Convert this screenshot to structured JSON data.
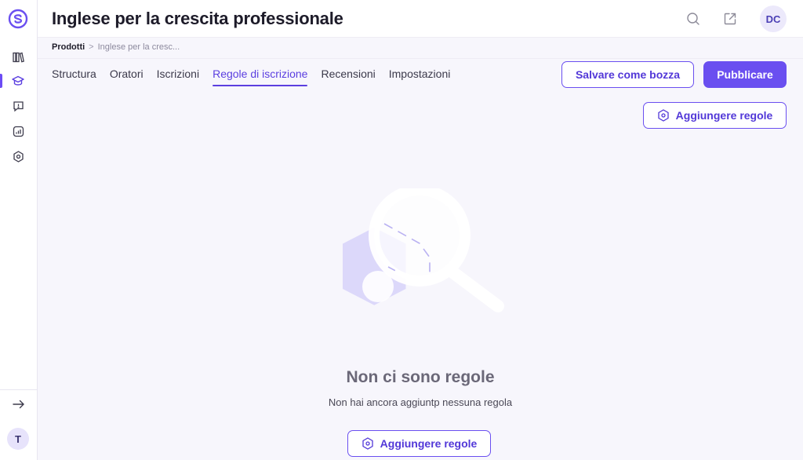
{
  "app": {
    "title": "Inglese per la crescita professionale"
  },
  "header": {
    "avatar_initials": "DC",
    "icons": [
      "search-icon",
      "external-link-icon"
    ]
  },
  "sidebar": {
    "items": [
      {
        "icon": "library-icon"
      },
      {
        "icon": "graduation-cap-icon",
        "active": true
      },
      {
        "icon": "chat-question-icon"
      },
      {
        "icon": "analytics-icon"
      },
      {
        "icon": "settings-hex-icon"
      }
    ],
    "user_initial": "T"
  },
  "breadcrumb": {
    "root": "Prodotti",
    "separator": ">",
    "current": "Inglese per la cresc..."
  },
  "tabs": [
    {
      "label": "Structura",
      "active": false
    },
    {
      "label": "Oratori",
      "active": false
    },
    {
      "label": "Iscrizioni",
      "active": false
    },
    {
      "label": "Regole di iscrizione",
      "active": true
    },
    {
      "label": "Recensioni",
      "active": false
    },
    {
      "label": "Impostazioni",
      "active": false
    }
  ],
  "actions": {
    "save_draft_label": "Salvare come bozza",
    "publish_label": "Pubblicare",
    "add_rules_label": "Aggiungere regole"
  },
  "empty_state": {
    "title": "Non ci sono regole",
    "subtitle": "Non hai ancora aggiuntp nessuna regola",
    "button_label": "Aggiungere regole"
  },
  "colors": {
    "accent": "#6a4ff0",
    "background": "#f7f6fc"
  }
}
